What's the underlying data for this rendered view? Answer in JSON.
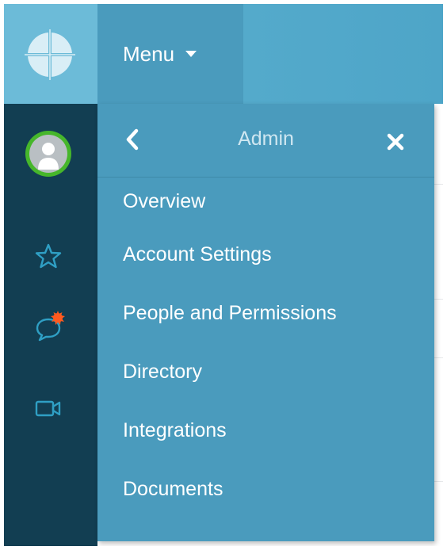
{
  "header": {
    "logo_icon": "crosshair-globe-icon",
    "menu_label": "Menu",
    "menu_caret_icon": "caret-down-icon"
  },
  "rail": {
    "avatar_icon": "user-avatar-icon",
    "items": [
      {
        "icon": "star-icon"
      },
      {
        "icon": "chat-bubble-icon",
        "notification_badge": true
      },
      {
        "icon": "video-camera-icon"
      }
    ]
  },
  "dropdown": {
    "title": "Admin",
    "back_icon": "chevron-left-icon",
    "close_icon": "close-icon",
    "items": [
      {
        "label": "Overview"
      },
      {
        "label": "Account Settings"
      },
      {
        "label": "People and Permissions"
      },
      {
        "label": "Directory"
      },
      {
        "label": "Integrations"
      },
      {
        "label": "Documents"
      }
    ]
  },
  "colors": {
    "topbar": "#5bb0cf",
    "menu_panel": "#4a9bbd",
    "rail": "#123e52",
    "avatar_ring": "#46b62b",
    "badge": "#ff5a1f",
    "rail_icon": "#2f9fc4"
  }
}
